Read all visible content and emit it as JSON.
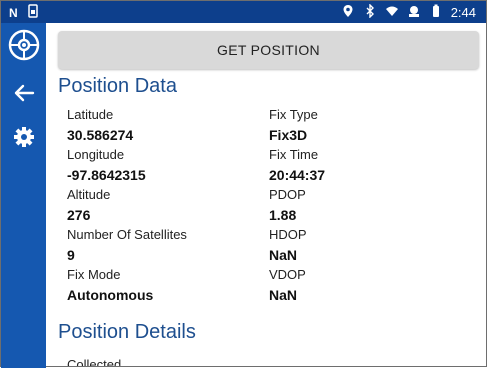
{
  "statusbar": {
    "time": "2:44",
    "left_icons": [
      "n-icon",
      "sim-card-icon"
    ],
    "right_icons": [
      "location-icon",
      "bluetooth-icon",
      "wifi-icon",
      "gps-icon",
      "battery-icon"
    ]
  },
  "sidebar": {
    "items": [
      {
        "icon": "app-logo-icon"
      },
      {
        "icon": "back-arrow-icon"
      },
      {
        "icon": "gear-icon"
      }
    ],
    "color": "#1558b0"
  },
  "main": {
    "get_position_label": "GET POSITION",
    "position_data_title": "Position Data",
    "position_details_title": "Position Details",
    "collected_label": "Collected",
    "left_fields": [
      {
        "label": "Latitude",
        "value": "30.586274"
      },
      {
        "label": "Longitude",
        "value": "-97.8642315"
      },
      {
        "label": "Altitude",
        "value": "276"
      },
      {
        "label": "Number Of Satellites",
        "value": "9"
      },
      {
        "label": "Fix Mode",
        "value": "Autonomous"
      }
    ],
    "right_fields": [
      {
        "label": "Fix Type",
        "value": "Fix3D"
      },
      {
        "label": "Fix Time",
        "value": "20:44:37"
      },
      {
        "label": "PDOP",
        "value": "1.88"
      },
      {
        "label": "HDOP",
        "value": "NaN"
      },
      {
        "label": "VDOP",
        "value": "NaN"
      }
    ]
  },
  "colors": {
    "statusbar": "#0d3f8c",
    "title": "#1e4f8f",
    "button": "#d9d9d9"
  }
}
